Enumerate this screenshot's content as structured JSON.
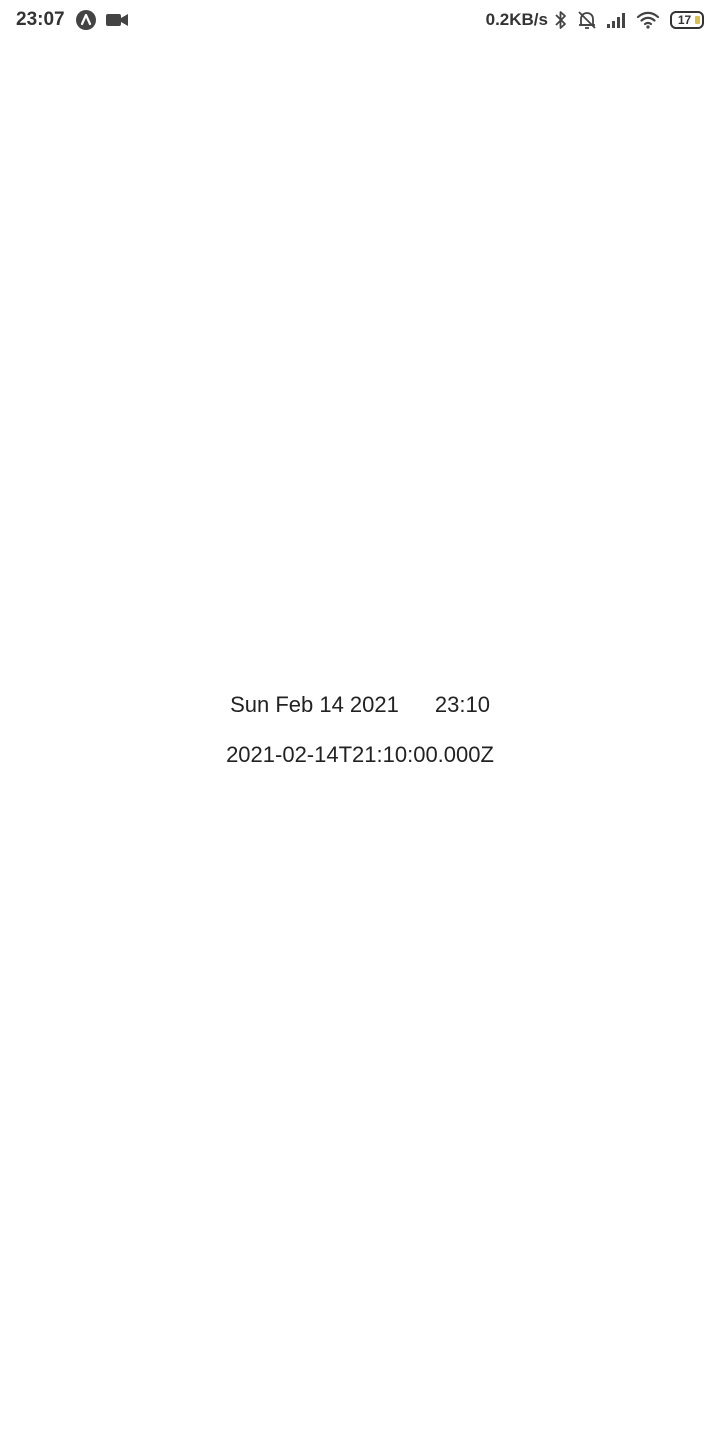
{
  "status_bar": {
    "time": "23:07",
    "network_speed": "0.2KB/s",
    "battery_level": "17",
    "icons": [
      "app-a-icon",
      "video-camera-icon",
      "bluetooth-icon",
      "alarm-off-icon",
      "signal-icon",
      "wifi-icon",
      "battery-icon"
    ]
  },
  "main": {
    "date_text": "Sun Feb 14 2021",
    "time_text": "23:10",
    "iso_text": "2021-02-14T21:10:00.000Z"
  }
}
